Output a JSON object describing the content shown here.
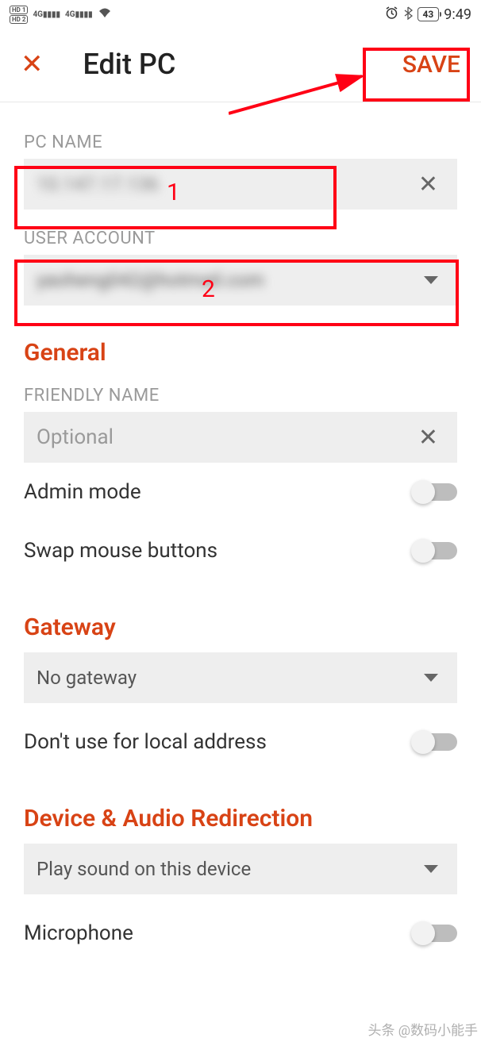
{
  "status_bar": {
    "hd1": "HD 1",
    "hd2": "HD 2",
    "sig1": "4G",
    "sig2": "4G",
    "battery": "43",
    "time": "9:49"
  },
  "header": {
    "title": "Edit PC",
    "save": "SAVE"
  },
  "annotations": {
    "num1": "1",
    "num2": "2"
  },
  "fields": {
    "pc_name_label": "PC NAME",
    "pc_name_value": "10.147.17.136",
    "user_account_label": "USER ACCOUNT",
    "user_account_value": "yaoheng042@hotmail.com",
    "friendly_name_label": "FRIENDLY NAME",
    "friendly_name_placeholder": "Optional"
  },
  "sections": {
    "general": "General",
    "gateway": "Gateway",
    "device_audio": "Device & Audio Redirection"
  },
  "toggles": {
    "admin_mode": "Admin mode",
    "swap_mouse": "Swap mouse buttons",
    "local_address": "Don't use for local address",
    "microphone": "Microphone"
  },
  "dropdowns": {
    "gateway_value": "No gateway",
    "audio_value": "Play sound on this device"
  },
  "watermark": "头条 @数码小能手"
}
